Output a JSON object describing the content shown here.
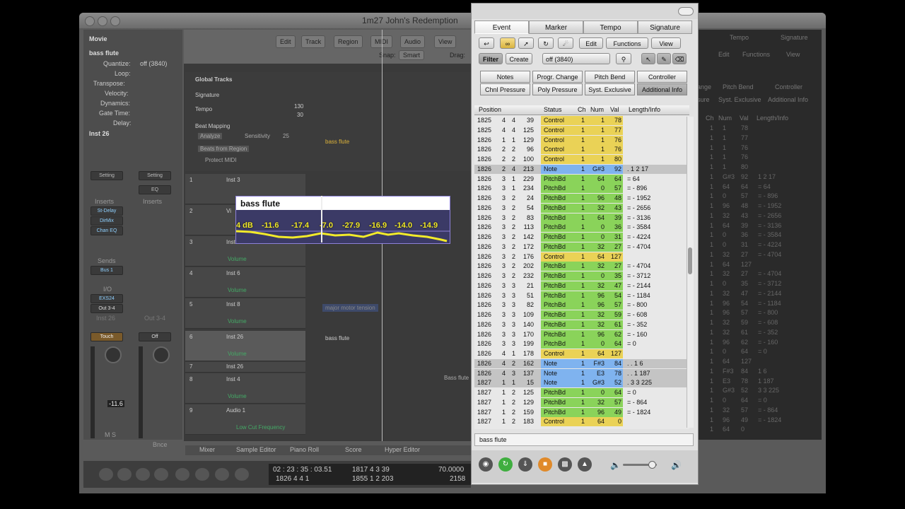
{
  "window_title": "1m27 John's Redemption",
  "inspector": {
    "movie": "Movie",
    "region": "bass flute",
    "params": [
      {
        "label": "Quantize:",
        "value": "off (3840)"
      },
      {
        "label": "Loop:",
        "value": ""
      },
      {
        "label": "Transpose:",
        "value": ""
      },
      {
        "label": "Velocity:",
        "value": ""
      },
      {
        "label": "Dynamics:",
        "value": ""
      },
      {
        "label": "Gate Time:",
        "value": ""
      },
      {
        "label": "Delay:",
        "value": ""
      }
    ],
    "inst": "Inst 26",
    "setting": "Setting",
    "eq": "EQ",
    "inserts": "Inserts",
    "plugins": [
      "St-Delay",
      "DirMix",
      "Chan EQ"
    ],
    "sends": "Sends",
    "bus": "Bus 1",
    "io": "I/O",
    "exs": "EXS24",
    "out": "Out 3-4",
    "out2": "Out 3-4",
    "inst2": "Inst 26",
    "touch": "Touch",
    "off": "Off",
    "meter": "-11.6",
    "ms": "M S",
    "bnce": "Bnce"
  },
  "arrange": {
    "toolbar": [
      "Edit",
      "Track",
      "Region",
      "MIDI",
      "Audio",
      "View"
    ],
    "snap_label": "Snap:",
    "snap_value": "Smart",
    "drag_label": "Drag:",
    "global_tracks": "Global Tracks",
    "signature": "Signature",
    "tempo": "Tempo",
    "tempo_values": [
      "130",
      "30"
    ],
    "beat_mapping": "Beat Mapping",
    "analyze": "Analyze",
    "sensitivity": "Sensitivity",
    "sensitivity_value": "25",
    "beats_from_region": "Beats from Region",
    "protect_midi": "Protect MIDI",
    "beat_region": "bass flute",
    "tracks": [
      {
        "num": "1",
        "name": "Inst 3",
        "lane": ""
      },
      {
        "num": "2",
        "name": "Vi",
        "lane": ""
      },
      {
        "num": "3",
        "name": "Inst 4",
        "lane": "Volume"
      },
      {
        "num": "4",
        "name": "Inst 6",
        "lane": "Volume"
      },
      {
        "num": "5",
        "name": "Inst 8",
        "lane": "Volume"
      },
      {
        "num": "6",
        "name": "Inst 26",
        "lane": "Volume"
      },
      {
        "num": "7",
        "name": "Inst 26",
        "lane": ""
      },
      {
        "num": "8",
        "name": "Inst 4",
        "lane": "Volume"
      },
      {
        "num": "9",
        "name": "Audio 1",
        "lane": "Low Cut Frequency"
      }
    ],
    "region_labels": [
      "major motor tension",
      "bass flute",
      "Bass flute"
    ],
    "bottom_tabs": [
      "Mixer",
      "Sample Editor",
      "Piano Roll",
      "Score",
      "Hyper Editor"
    ]
  },
  "transport": {
    "time_top": "02 : 23 : 35 : 03.51",
    "time_bottom": "1826    4    4    1",
    "pos_top": "1817    4    3    39",
    "pos_bottom": "1855    1    2  203",
    "tempo_top": "70.0000",
    "tempo_bottom": "2158"
  },
  "overlay": {
    "title": "bass flute",
    "values": [
      "4 dB",
      "-11.6",
      "-17.4",
      "-7.0",
      "-27.9",
      "-16.9",
      "-14.0",
      "-14.9"
    ]
  },
  "event_list": {
    "tabs": [
      "Event",
      "Marker",
      "Tempo",
      "Signature"
    ],
    "active_tab": "Event",
    "menus": [
      "Edit",
      "Functions",
      "View"
    ],
    "filter": "Filter",
    "create": "Create",
    "quantize": "off (3840)",
    "filters": [
      [
        "Notes",
        "Progr. Change",
        "Pitch Bend",
        "Controller"
      ],
      [
        "Chnl Pressure",
        "Poly Pressure",
        "Syst. Exclusive",
        "Additional Info"
      ]
    ],
    "selected_filter": "Additional Info",
    "columns": [
      "Position",
      "Status",
      "Ch",
      "Num",
      "Val",
      "Length/Info"
    ],
    "rows": [
      {
        "p": [
          "1825",
          "4",
          "4",
          "39"
        ],
        "s": "Control",
        "ch": "1",
        "num": "1",
        "val": "78",
        "li": ""
      },
      {
        "p": [
          "1825",
          "4",
          "4",
          "125"
        ],
        "s": "Control",
        "ch": "1",
        "num": "1",
        "val": "77",
        "li": ""
      },
      {
        "p": [
          "1826",
          "1",
          "1",
          "129"
        ],
        "s": "Control",
        "ch": "1",
        "num": "1",
        "val": "76",
        "li": ""
      },
      {
        "p": [
          "1826",
          "2",
          "2",
          "96"
        ],
        "s": "Control",
        "ch": "1",
        "num": "1",
        "val": "76",
        "li": ""
      },
      {
        "p": [
          "1826",
          "2",
          "2",
          "100"
        ],
        "s": "Control",
        "ch": "1",
        "num": "1",
        "val": "80",
        "li": ""
      },
      {
        "p": [
          "1826",
          "2",
          "4",
          "213"
        ],
        "s": "Note",
        "ch": "1",
        "num": "G#3",
        "val": "92",
        "li": ".  1   2   17"
      },
      {
        "p": [
          "1826",
          "3",
          "1",
          "229"
        ],
        "s": "PitchBd",
        "ch": "1",
        "num": "64",
        "val": "64",
        "li": "=            64"
      },
      {
        "p": [
          "1826",
          "3",
          "1",
          "234"
        ],
        "s": "PitchBd",
        "ch": "1",
        "num": "0",
        "val": "57",
        "li": "=      -   896"
      },
      {
        "p": [
          "1826",
          "3",
          "2",
          "24"
        ],
        "s": "PitchBd",
        "ch": "1",
        "num": "96",
        "val": "48",
        "li": "=      - 1952"
      },
      {
        "p": [
          "1826",
          "3",
          "2",
          "54"
        ],
        "s": "PitchBd",
        "ch": "1",
        "num": "32",
        "val": "43",
        "li": "=      - 2656"
      },
      {
        "p": [
          "1826",
          "3",
          "2",
          "83"
        ],
        "s": "PitchBd",
        "ch": "1",
        "num": "64",
        "val": "39",
        "li": "=      - 3136"
      },
      {
        "p": [
          "1826",
          "3",
          "2",
          "113"
        ],
        "s": "PitchBd",
        "ch": "1",
        "num": "0",
        "val": "36",
        "li": "=      - 3584"
      },
      {
        "p": [
          "1826",
          "3",
          "2",
          "142"
        ],
        "s": "PitchBd",
        "ch": "1",
        "num": "0",
        "val": "31",
        "li": "=      - 4224"
      },
      {
        "p": [
          "1826",
          "3",
          "2",
          "172"
        ],
        "s": "PitchBd",
        "ch": "1",
        "num": "32",
        "val": "27",
        "li": "=      - 4704"
      },
      {
        "p": [
          "1826",
          "3",
          "2",
          "176"
        ],
        "s": "Control",
        "ch": "1",
        "num": "64",
        "val": "127",
        "li": ""
      },
      {
        "p": [
          "1826",
          "3",
          "2",
          "202"
        ],
        "s": "PitchBd",
        "ch": "1",
        "num": "32",
        "val": "27",
        "li": "=      - 4704"
      },
      {
        "p": [
          "1826",
          "3",
          "2",
          "232"
        ],
        "s": "PitchBd",
        "ch": "1",
        "num": "0",
        "val": "35",
        "li": "=      - 3712"
      },
      {
        "p": [
          "1826",
          "3",
          "3",
          "21"
        ],
        "s": "PitchBd",
        "ch": "1",
        "num": "32",
        "val": "47",
        "li": "=      - 2144"
      },
      {
        "p": [
          "1826",
          "3",
          "3",
          "51"
        ],
        "s": "PitchBd",
        "ch": "1",
        "num": "96",
        "val": "54",
        "li": "=      - 1184"
      },
      {
        "p": [
          "1826",
          "3",
          "3",
          "82"
        ],
        "s": "PitchBd",
        "ch": "1",
        "num": "96",
        "val": "57",
        "li": "=      -   800"
      },
      {
        "p": [
          "1826",
          "3",
          "3",
          "109"
        ],
        "s": "PitchBd",
        "ch": "1",
        "num": "32",
        "val": "59",
        "li": "=      -   608"
      },
      {
        "p": [
          "1826",
          "3",
          "3",
          "140"
        ],
        "s": "PitchBd",
        "ch": "1",
        "num": "32",
        "val": "61",
        "li": "=      -   352"
      },
      {
        "p": [
          "1826",
          "3",
          "3",
          "170"
        ],
        "s": "PitchBd",
        "ch": "1",
        "num": "96",
        "val": "62",
        "li": "=      -   160"
      },
      {
        "p": [
          "1826",
          "3",
          "3",
          "199"
        ],
        "s": "PitchBd",
        "ch": "1",
        "num": "0",
        "val": "64",
        "li": "=              0"
      },
      {
        "p": [
          "1826",
          "4",
          "1",
          "178"
        ],
        "s": "Control",
        "ch": "1",
        "num": "64",
        "val": "127",
        "li": ""
      },
      {
        "p": [
          "1826",
          "4",
          "2",
          "162"
        ],
        "s": "Note",
        "ch": "1",
        "num": "F#3",
        "val": "84",
        "li": ".   .   1    6"
      },
      {
        "p": [
          "1826",
          "4",
          "3",
          "137"
        ],
        "s": "Note",
        "ch": "1",
        "num": "E3",
        "val": "78",
        "li": ".   .   1  187"
      },
      {
        "p": [
          "1827",
          "1",
          "1",
          "15"
        ],
        "s": "Note",
        "ch": "1",
        "num": "G#3",
        "val": "52",
        "li": ".   3   3  225"
      },
      {
        "p": [
          "1827",
          "1",
          "2",
          "125"
        ],
        "s": "PitchBd",
        "ch": "1",
        "num": "0",
        "val": "64",
        "li": "=              0"
      },
      {
        "p": [
          "1827",
          "1",
          "2",
          "129"
        ],
        "s": "PitchBd",
        "ch": "1",
        "num": "32",
        "val": "57",
        "li": "=      -   864"
      },
      {
        "p": [
          "1827",
          "1",
          "2",
          "159"
        ],
        "s": "PitchBd",
        "ch": "1",
        "num": "96",
        "val": "49",
        "li": "=      - 1824"
      },
      {
        "p": [
          "1827",
          "1",
          "2",
          "183"
        ],
        "s": "Control",
        "ch": "1",
        "num": "64",
        "val": "0",
        "li": ""
      }
    ],
    "status_text": "bass flute"
  },
  "right_dim": {
    "tabs": [
      "Tempo",
      "Signature"
    ],
    "menus": [
      "Edit",
      "Functions",
      "View"
    ],
    "filters": [
      "ange",
      "Pitch Bend",
      "Controller",
      "sure",
      "Syst. Exclusive",
      "Additional Info"
    ],
    "columns": [
      "Ch",
      "Num",
      "Val",
      "Length/Info"
    ],
    "rows": [
      [
        "1",
        "1",
        "78",
        ""
      ],
      [
        "1",
        "1",
        "77",
        ""
      ],
      [
        "1",
        "1",
        "76",
        ""
      ],
      [
        "1",
        "1",
        "76",
        ""
      ],
      [
        "1",
        "1",
        "80",
        ""
      ],
      [
        "1",
        "G#3",
        "92",
        "1    2    17"
      ],
      [
        "1",
        "64",
        "64",
        "=              64"
      ],
      [
        "1",
        "0",
        "57",
        "=      -   896"
      ],
      [
        "1",
        "96",
        "48",
        "=      - 1952"
      ],
      [
        "1",
        "32",
        "43",
        "=      - 2656"
      ],
      [
        "1",
        "64",
        "39",
        "=      - 3136"
      ],
      [
        "1",
        "0",
        "36",
        "=      - 3584"
      ],
      [
        "1",
        "0",
        "31",
        "=      - 4224"
      ],
      [
        "1",
        "32",
        "27",
        "=      - 4704"
      ],
      [
        "1",
        "64",
        "127",
        ""
      ],
      [
        "1",
        "32",
        "27",
        "=      - 4704"
      ],
      [
        "1",
        "0",
        "35",
        "=      - 3712"
      ],
      [
        "1",
        "32",
        "47",
        "=      - 2144"
      ],
      [
        "1",
        "96",
        "54",
        "=      - 1184"
      ],
      [
        "1",
        "96",
        "57",
        "=      -   800"
      ],
      [
        "1",
        "32",
        "59",
        "=      -   608"
      ],
      [
        "1",
        "32",
        "61",
        "=      -   352"
      ],
      [
        "1",
        "96",
        "62",
        "=      -   160"
      ],
      [
        "1",
        "0",
        "64",
        "=              0"
      ],
      [
        "1",
        "64",
        "127",
        ""
      ],
      [
        "1",
        "F#3",
        "84",
        "1      6"
      ],
      [
        "1",
        "E3",
        "78",
        "1   187"
      ],
      [
        "1",
        "G#3",
        "52",
        "3   3  225"
      ],
      [
        "1",
        "0",
        "64",
        "=              0"
      ],
      [
        "1",
        "32",
        "57",
        "=      -   864"
      ],
      [
        "1",
        "96",
        "49",
        "=      - 1824"
      ],
      [
        "1",
        "64",
        "0",
        ""
      ]
    ]
  },
  "colors": {
    "control": "#ead256",
    "note": "#7fb3ef",
    "pitchbd": "#8ad35a",
    "selected_row": "#c4c4c4",
    "overlay_curve": "#f2ea2a",
    "overlay_bg": "#3b3a66"
  }
}
